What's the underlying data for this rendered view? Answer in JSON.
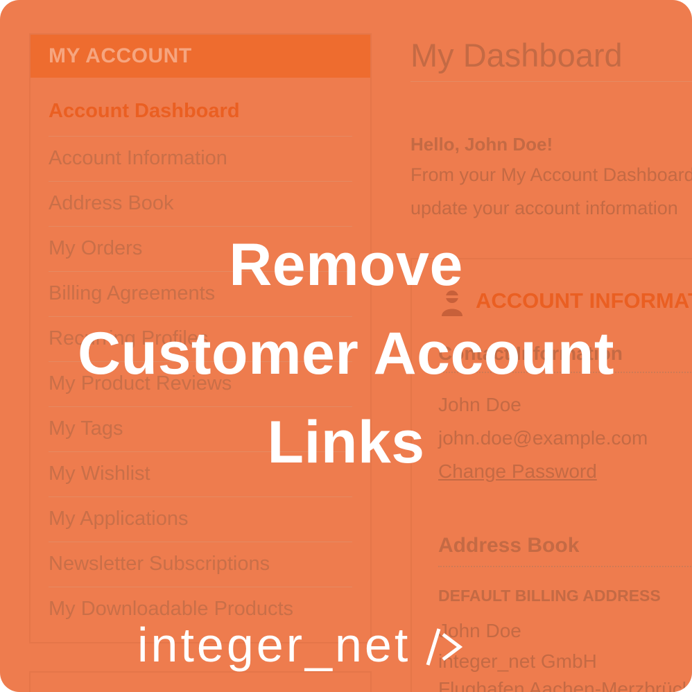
{
  "sidebar": {
    "header": "MY ACCOUNT",
    "items": [
      {
        "label": "Account Dashboard"
      },
      {
        "label": "Account Information"
      },
      {
        "label": "Address Book"
      },
      {
        "label": "My Orders"
      },
      {
        "label": "Billing Agreements"
      },
      {
        "label": "Recurring Profiles"
      },
      {
        "label": "My Product Reviews"
      },
      {
        "label": "My Tags"
      },
      {
        "label": "My Wishlist"
      },
      {
        "label": "My Applications"
      },
      {
        "label": "Newsletter Subscriptions"
      },
      {
        "label": "My Downloadable Products"
      }
    ]
  },
  "main": {
    "title": "My Dashboard",
    "greeting": "Hello, John Doe!",
    "intro_line1": "From your My Account Dashboard",
    "intro_line2": "update your account information",
    "account_info": {
      "heading": "ACCOUNT INFORMATION",
      "contact_heading": "Contact Information",
      "name": "John Doe",
      "email": "john.doe@example.com",
      "change_password": "Change Password"
    },
    "address_book": {
      "heading": "Address Book",
      "billing_heading": "DEFAULT BILLING ADDRESS",
      "line1": "John Doe",
      "line2": "integer_net GmbH",
      "line3": "Flughafen Aachen-Merzbrück"
    }
  },
  "overlay": {
    "line1": "Remove",
    "line2": "Customer Account",
    "line3": "Links"
  },
  "logo": {
    "text": "integer_net"
  },
  "colors": {
    "background": "#ee7c4e",
    "accent": "#ea5f22",
    "overlay_text": "#ffffff"
  }
}
